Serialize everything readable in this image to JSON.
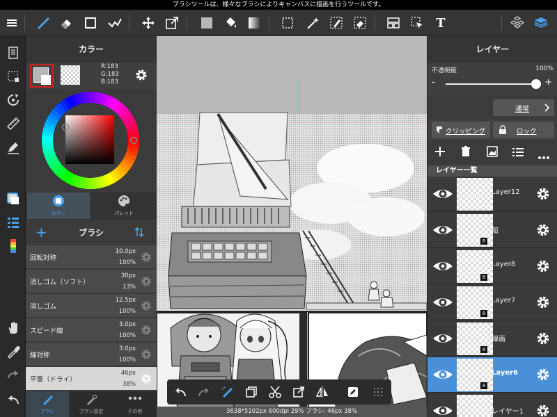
{
  "status_message": "ブラシツールは、様々なブラシによりキャンバスに描画を行うツールです。",
  "toolbar": {
    "icons": [
      "menu-icon",
      "brush-icon",
      "eraser-icon",
      "rectangle-icon",
      "magic-select-icon",
      "move-icon",
      "transform-icon",
      "fill-color-icon",
      "bucket-icon",
      "gradient-icon",
      "selection-icon",
      "magic-wand-icon",
      "select-pen-icon",
      "select-eraser-icon",
      "panel-layout-icon",
      "text-select-icon",
      "text-icon",
      "material-icon",
      "layers-icon"
    ],
    "text_tool_label": "T"
  },
  "color_panel": {
    "title": "カラー",
    "r": "R:183",
    "g": "G:183",
    "b": "B:183",
    "primary_color": "#b7b7b7",
    "tab_color": "カラー",
    "tab_palette": "パレット"
  },
  "brush_panel": {
    "title": "ブラシ",
    "add_label": "+",
    "brushes": [
      {
        "name": "回転対称",
        "size": "10.0px",
        "opacity": "100%"
      },
      {
        "name": "消しゴム（ソフト）",
        "size": "30px",
        "opacity": "13%"
      },
      {
        "name": "消しゴム",
        "size": "12.5px",
        "opacity": "100%"
      },
      {
        "name": "スピード線",
        "size": "3.0px",
        "opacity": "100%"
      },
      {
        "name": "線対称",
        "size": "3.0px",
        "opacity": "100%"
      },
      {
        "name": "平筆（ドライ）",
        "size": "46px",
        "opacity": "38%"
      }
    ],
    "selected_index": 5,
    "bottom_tabs": [
      "ブラシ",
      "ブラシ設定",
      "その他"
    ]
  },
  "layer_panel": {
    "title": "レイヤー",
    "opacity_label": "不透明度",
    "opacity_value": "100%",
    "opacity_fraction": 1.0,
    "minus": "-",
    "plus": "+",
    "blend_mode": "通常",
    "clipping": "クリッピング",
    "lock": "ロック",
    "list_title": "レイヤー一覧",
    "layers": [
      {
        "name": "Layer12",
        "badge": ""
      },
      {
        "name": "船",
        "badge": "8"
      },
      {
        "name": "Layer8",
        "badge": "8"
      },
      {
        "name": "Layer7",
        "badge": "8"
      },
      {
        "name": "線画",
        "badge": "8"
      },
      {
        "name": "Layer6",
        "badge": "8"
      },
      {
        "name": "レイヤー1",
        "badge": ""
      }
    ],
    "selected_index": 5
  },
  "canvas": {
    "info": "3638*5102px 600dpi 29% ブラシ: 46px 38%"
  },
  "colors": {
    "accent": "#4a90d9",
    "selected_color_border": "#d02020"
  }
}
